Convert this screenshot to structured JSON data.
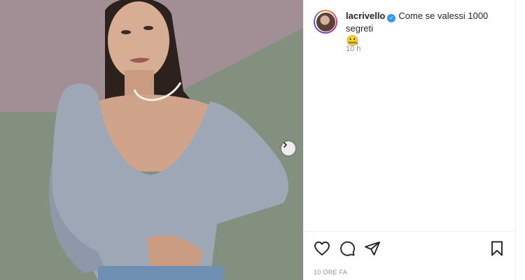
{
  "post": {
    "username": "lacrivello",
    "caption": "Come se valessi 1000 segreti",
    "caption_emoji": "🤐",
    "time_ago": "10 h",
    "date_label": "10 ORE FA"
  },
  "icons": {
    "verified": "verified-badge-icon",
    "next": "chevron-right-icon",
    "like": "heart-icon",
    "comment": "comment-icon",
    "share": "paper-plane-icon",
    "save": "bookmark-icon"
  },
  "colors": {
    "verified_blue": "#3897f0",
    "text": "#262626",
    "muted": "#8e8e8e"
  }
}
